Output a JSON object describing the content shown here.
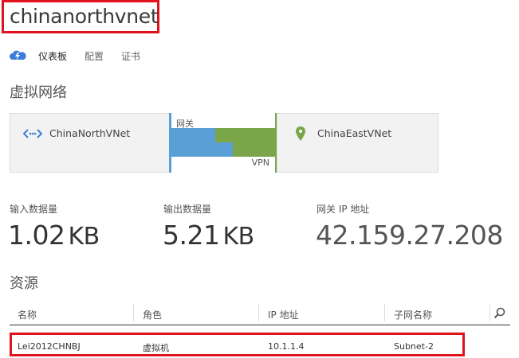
{
  "header": {
    "title": "chinanorthvnet"
  },
  "tabs": [
    {
      "label": "仪表板",
      "active": true
    },
    {
      "label": "配置",
      "active": false
    },
    {
      "label": "证书",
      "active": false
    }
  ],
  "sections": {
    "vnet": "虚拟网络",
    "resources": "资源"
  },
  "topology": {
    "left_vnet": "ChinaNorthVNet",
    "right_vnet": "ChinaEastVNet",
    "gateway_label": "网关",
    "connection_label": "VPN",
    "colors": {
      "left": "#5a9fd6",
      "right": "#7aa548"
    }
  },
  "metrics": [
    {
      "label": "输入数据量",
      "value": "1.02",
      "unit": "KB"
    },
    {
      "label": "输出数据量",
      "value": "5.21",
      "unit": "KB"
    },
    {
      "label": "网关 IP 地址",
      "value": "42.159.27.208",
      "unit": ""
    }
  ],
  "resources_table": {
    "columns": [
      "名称",
      "角色",
      "IP 地址",
      "子网名称"
    ],
    "rows": [
      {
        "name": "Lei2012CHNBJ",
        "role": "虚拟机",
        "ip": "10.1.1.4",
        "subnet": "Subnet-2"
      }
    ]
  },
  "icons": {
    "dashboard": "cloud-lightning-icon",
    "left_vnet": "network-arrows-icon",
    "right_vnet": "location-pin-icon",
    "search": "search-icon"
  }
}
